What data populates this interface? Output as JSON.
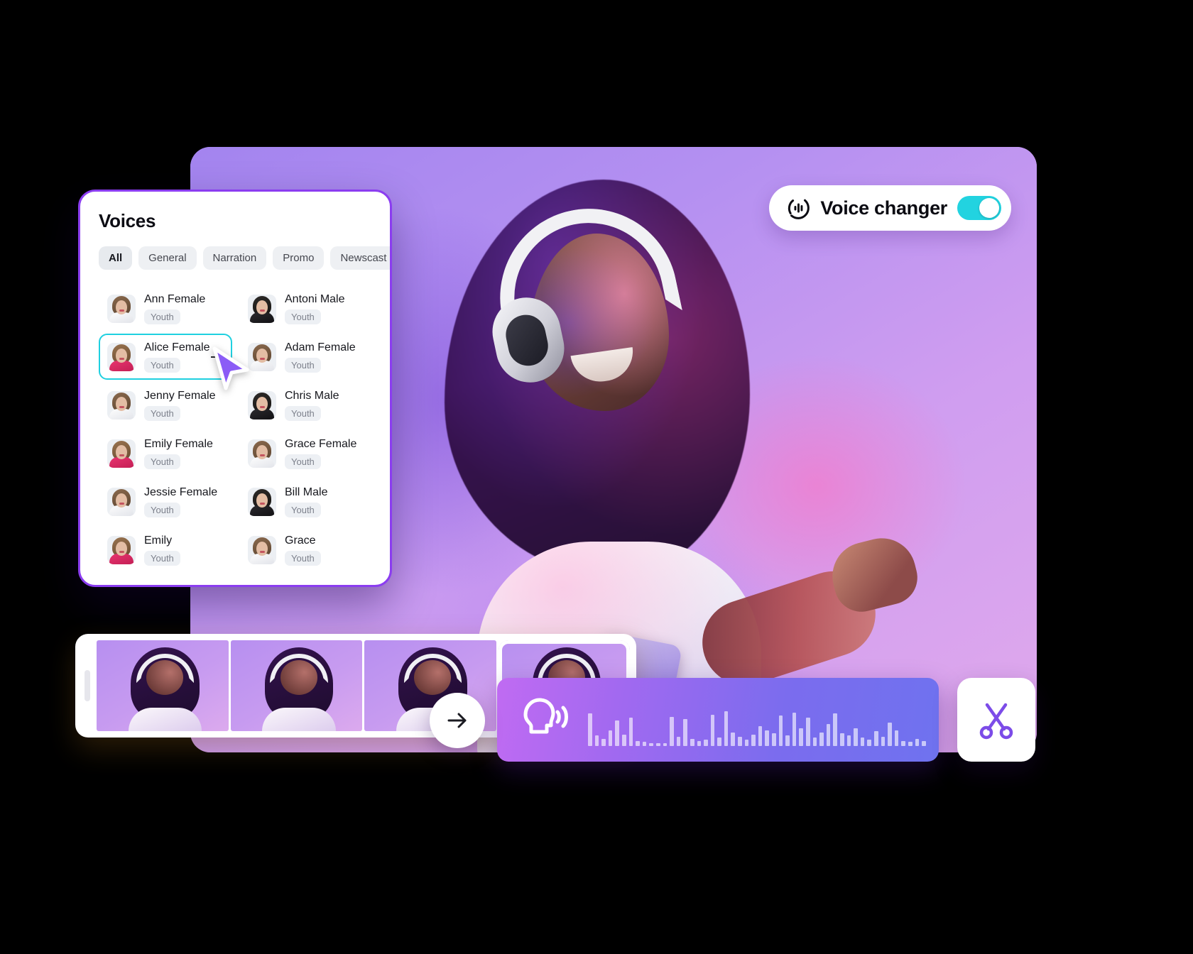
{
  "colors": {
    "accent_purple": "#8b3df0",
    "toggle_on_cyan": "#22d3e0",
    "selection_cyan": "#1fd0e0",
    "panel_white": "#ffffff",
    "chip_grey": "#eef0f3",
    "canvas_purple": "#b18cf2"
  },
  "voice_changer": {
    "label": "Voice changer",
    "icon": "audio-wave-circle-icon",
    "toggle_state": "on",
    "toggle_icon": "toggle-switch-icon"
  },
  "voices_panel": {
    "title": "Voices",
    "filter_icon": "filter-sort-icon",
    "categories": [
      {
        "label": "All",
        "active": true
      },
      {
        "label": "General",
        "active": false
      },
      {
        "label": "Narration",
        "active": false
      },
      {
        "label": "Promo",
        "active": false
      },
      {
        "label": "Newscast",
        "active": false
      }
    ],
    "voices": [
      {
        "name": "Ann Female",
        "tag": "Youth",
        "avatar": "female-avatar-white-shirt",
        "selected": false
      },
      {
        "name": "Antoni Male",
        "tag": "Youth",
        "avatar": "male-avatar-dark-jacket",
        "selected": false
      },
      {
        "name": "Alice Female",
        "tag": "Youth",
        "avatar": "female-avatar-pink-top",
        "selected": true
      },
      {
        "name": "Adam Female",
        "tag": "Youth",
        "avatar": "female-avatar-white-shirt",
        "selected": false
      },
      {
        "name": "Jenny Female",
        "tag": "Youth",
        "avatar": "female-avatar-white-shirt",
        "selected": false
      },
      {
        "name": "Chris Male",
        "tag": "Youth",
        "avatar": "male-avatar-dark-jacket",
        "selected": false
      },
      {
        "name": "Emily Female",
        "tag": "Youth",
        "avatar": "female-avatar-pink-top",
        "selected": false
      },
      {
        "name": "Grace Female",
        "tag": "Youth",
        "avatar": "female-avatar-white-shirt",
        "selected": false
      },
      {
        "name": "Jessie Female",
        "tag": "Youth",
        "avatar": "female-avatar-white-shirt",
        "selected": false
      },
      {
        "name": "Bill Male",
        "tag": "Youth",
        "avatar": "male-avatar-dark-jacket",
        "selected": false
      },
      {
        "name": "Emily",
        "tag": "Youth",
        "avatar": "female-avatar-pink-top",
        "selected": false
      },
      {
        "name": "Grace",
        "tag": "Youth",
        "avatar": "female-avatar-white-shirt",
        "selected": false
      }
    ]
  },
  "timeline": {
    "handle_icon": "drag-handle-icon",
    "clips": [
      {
        "name": "clip-1",
        "selected": false
      },
      {
        "name": "clip-2",
        "selected": false
      },
      {
        "name": "clip-3",
        "selected": false
      },
      {
        "name": "clip-4",
        "selected": true
      }
    ],
    "next_button_icon": "arrow-right-icon",
    "cut_button_icon": "scissors-icon"
  },
  "audio_track": {
    "icon": "speaking-head-icon",
    "waveform_levels": [
      62,
      20,
      14,
      30,
      48,
      22,
      54,
      10,
      8,
      6,
      6,
      6,
      56,
      18,
      52,
      14,
      10,
      12,
      60,
      16,
      66,
      26,
      18,
      12,
      22,
      38,
      30,
      24,
      58,
      20,
      64,
      34,
      54,
      16,
      26,
      42,
      62,
      24,
      20,
      34,
      16,
      12,
      28,
      18,
      44,
      30,
      10,
      8,
      14,
      10
    ]
  }
}
